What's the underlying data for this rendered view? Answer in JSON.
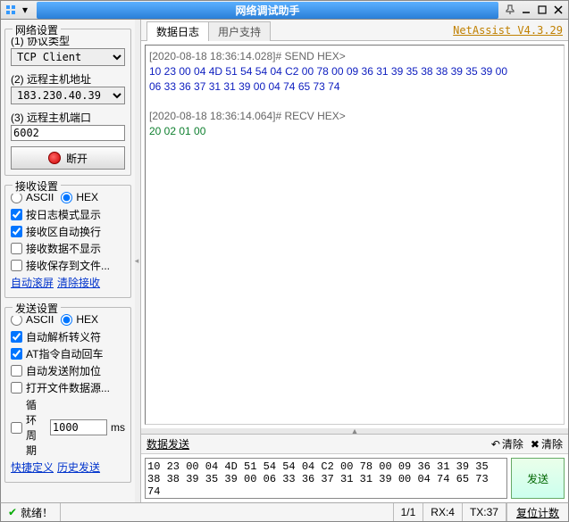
{
  "title": "网络调试助手",
  "version_label": "NetAssist V4.3.29",
  "tabs": {
    "data_log": "数据日志",
    "user_support": "用户支持"
  },
  "network_settings": {
    "legend": "网络设置",
    "protocol_label": "(1) 协议类型",
    "protocol_value": "TCP Client",
    "remote_host_label": "(2) 远程主机地址",
    "remote_host_value": "183.230.40.39",
    "remote_port_label": "(3) 远程主机端口",
    "remote_port_value": "6002",
    "disconnect_label": "断开"
  },
  "recv_settings": {
    "legend": "接收设置",
    "ascii": "ASCII",
    "hex": "HEX",
    "chk_log_mode": "按日志模式显示",
    "chk_log_mode_value": true,
    "chk_auto_wrap": "接收区自动换行",
    "chk_auto_wrap_value": true,
    "chk_hide_recv": "接收数据不显示",
    "chk_hide_recv_value": false,
    "chk_save_file": "接收保存到文件...",
    "chk_save_file_value": false,
    "link_autoscroll": "自动滚屏",
    "link_clear_recv": "清除接收"
  },
  "send_settings": {
    "legend": "发送设置",
    "ascii": "ASCII",
    "hex": "HEX",
    "chk_escape": "自动解析转义符",
    "chk_escape_value": true,
    "chk_at_cr": "AT指令自动回车",
    "chk_at_cr_value": true,
    "chk_append": "自动发送附加位",
    "chk_append_value": false,
    "chk_open_file": "打开文件数据源...",
    "chk_open_file_value": false,
    "loop_label": "循环周期",
    "loop_value": "1000",
    "loop_unit": "ms",
    "link_shortcut": "快捷定义",
    "link_history": "历史发送"
  },
  "log": {
    "send_ts": "[2020-08-18 18:36:14.028]# SEND HEX>",
    "send_body_line1": "10 23 00 04 4D 51 54 54 04 C2 00 78 00 09 36 31 39 35 38 38 39 35 39 00",
    "send_body_line2": "06 33 36 37 31 31 39 00 04 74 65 73 74",
    "recv_ts": "[2020-08-18 18:36:14.064]# RECV HEX>",
    "recv_body": "20 02 01 00"
  },
  "send_panel": {
    "title": "数据发送",
    "clear1": "清除",
    "clear2": "清除",
    "text": "10 23 00 04 4D 51 54 54 04 C2 00 78 00 09 36 31 39 35 38 38 39 35 39 00 06 33 36 37 31 31 39 00 04 74 65 73 74",
    "send_btn": "发送"
  },
  "status": {
    "ready": "就绪！",
    "counter": "1/1",
    "rx": "RX:4",
    "tx": "TX:37",
    "reset": "复位计数"
  }
}
